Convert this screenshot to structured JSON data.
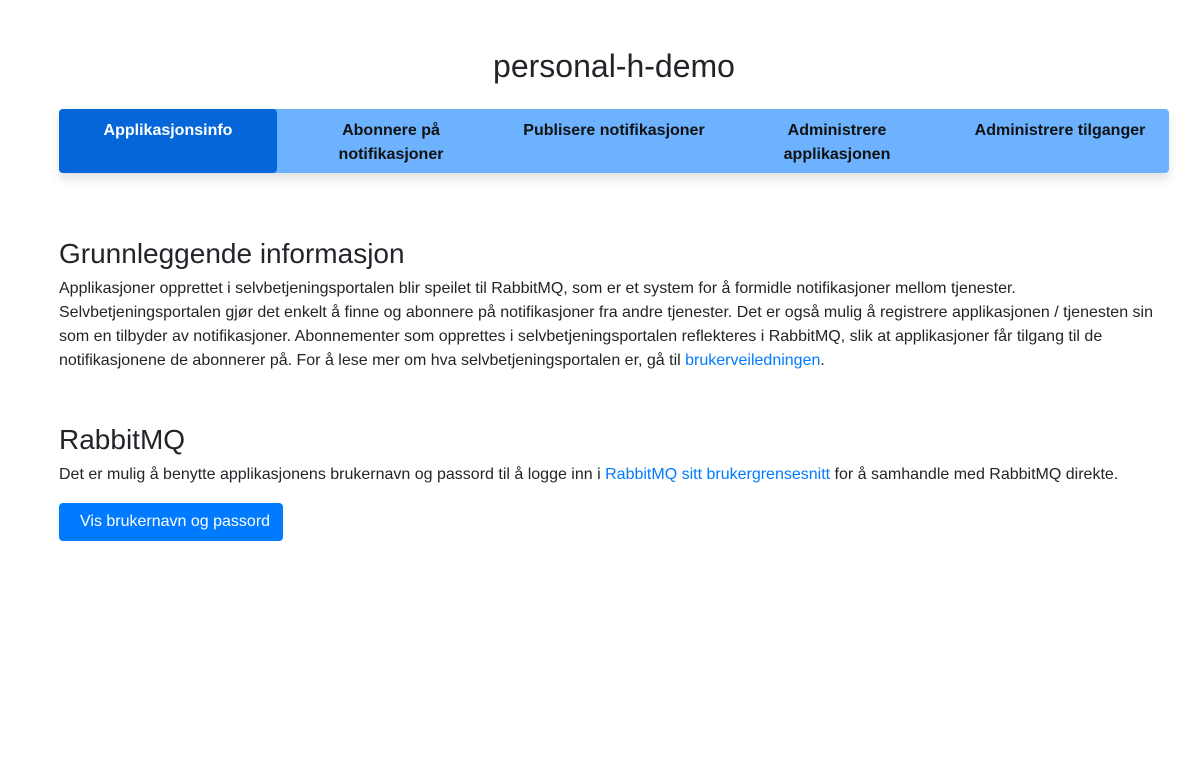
{
  "app": {
    "title": "personal-h-demo"
  },
  "tabs": [
    {
      "label": "Applikasjonsinfo",
      "active": true
    },
    {
      "label": "Abonnere på notifikasjoner",
      "active": false
    },
    {
      "label": "Publisere notifikasjoner",
      "active": false
    },
    {
      "label": "Administrere applikasjonen",
      "active": false
    },
    {
      "label": "Administrere tilganger",
      "active": false
    }
  ],
  "basic_info": {
    "heading": "Grunnleggende informasjon",
    "text_before_link": "Applikasjoner opprettet i selvbetjeningsportalen blir speilet til RabbitMQ, som er et system for å formidle notifikasjoner mellom tjenester. Selvbetjeningsportalen gjør det enkelt å finne og abonnere på notifikasjoner fra andre tjenester. Det er også mulig å registrere applikasjonen / tjenesten sin som en tilbyder av notifikasjoner. Abonnementer som opprettes i selvbetjeningsportalen reflekteres i RabbitMQ, slik at applikasjoner får tilgang til de notifikasjonene de abonnerer på. For å lese mer om hva selvbetjeningsportalen er, gå til ",
    "link_label": "brukerveiledningen",
    "text_after_link": "."
  },
  "rabbitmq": {
    "heading": "RabbitMQ",
    "text_before_link": "Det er mulig å benytte applikasjonens brukernavn og passord til å logge inn i ",
    "link_label": "RabbitMQ sitt brukergrensesnitt",
    "text_after_link": " for å samhandle med RabbitMQ direkte.",
    "button_label": "Vis brukernavn og passord"
  },
  "colors": {
    "tab_bar": "#6cb2ff",
    "tab_active": "#0466d8",
    "link": "#007bff",
    "button": "#007bff"
  }
}
